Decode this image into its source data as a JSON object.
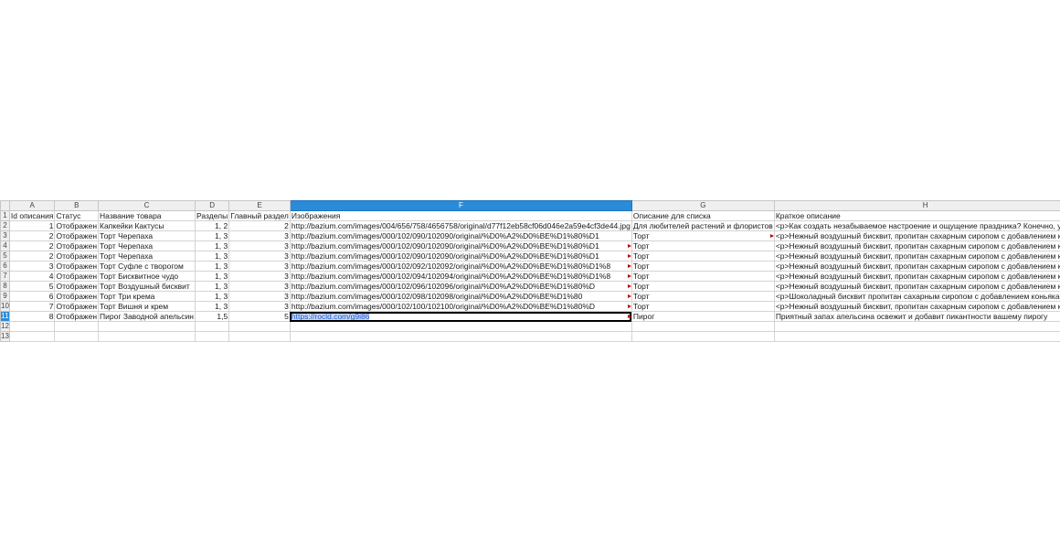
{
  "columns": [
    "A",
    "B",
    "C",
    "D",
    "E",
    "F",
    "G",
    "H"
  ],
  "active_cell": "F11",
  "rows": [
    {
      "n": "1",
      "cells": [
        "Id описания",
        "Статус",
        "Название товара",
        "Разделы",
        "Главный раздел",
        "Изображения",
        "Описание для списка",
        "Краткое описание"
      ]
    },
    {
      "n": "2",
      "cells": [
        "1",
        "Отображен",
        "Капкейки Кактусы",
        "1, 2",
        "2",
        "http://bazium.com/images/004/656/758/4656758/original/d77f12eb58cf06d046e2a59e4cf3de44.jpg",
        "Для любителей растений и флористов",
        "<p>Как создать незабываемое настроение и ощущение праздника? Конечно, уди"
      ]
    },
    {
      "n": "3",
      "cells": [
        "2",
        "Отображен",
        "Торт Черепаха",
        "1, 3",
        "3",
        "http://bazium.com/images/000/102/090/102090/original/%D0%A2%D0%BE%D1%80%D1",
        "Торт",
        "<p>Нежный воздушный бисквит, пропитан сахарным сиропом с добавлением кон"
      ]
    },
    {
      "n": "4",
      "cells": [
        "2",
        "Отображен",
        "Торт Черепаха",
        "1, 3",
        "3",
        "http://bazium.com/images/000/102/090/102090/original/%D0%A2%D0%BE%D1%80%D1",
        "Торт",
        "<p>Нежный воздушный бисквит, пропитан сахарным сиропом с добавлением кон"
      ]
    },
    {
      "n": "5",
      "cells": [
        "2",
        "Отображен",
        "Торт Черепаха",
        "1, 3",
        "3",
        "http://bazium.com/images/000/102/090/102090/original/%D0%A2%D0%BE%D1%80%D1",
        "Торт",
        "<p>Нежный воздушный бисквит, пропитан сахарным сиропом с добавлением кон"
      ]
    },
    {
      "n": "6",
      "cells": [
        "3",
        "Отображен",
        "Торт Суфле с творогом",
        "1, 3",
        "3",
        "http://bazium.com/images/000/102/092/102092/original/%D0%A2%D0%BE%D1%80%D1%8",
        "Торт",
        "<p>Нежный воздушный бисквит, пропитан сахарным сиропом с добавлением кон"
      ]
    },
    {
      "n": "7",
      "cells": [
        "4",
        "Отображен",
        "Торт Бисквитное чудо",
        "1, 3",
        "3",
        "http://bazium.com/images/000/102/094/102094/original/%D0%A2%D0%BE%D1%80%D1%8",
        "Торт",
        "<p>Нежный воздушный бисквит, пропитан сахарным сиропом с добавлением кон"
      ]
    },
    {
      "n": "8",
      "cells": [
        "5",
        "Отображен",
        "Торт Воздушный бисквит",
        "1, 3",
        "3",
        "http://bazium.com/images/000/102/096/102096/original/%D0%A2%D0%BE%D1%80%D",
        "Торт",
        "<p>Нежный воздушный бисквит, пропитан сахарным сиропом с добавлением кон"
      ]
    },
    {
      "n": "9",
      "cells": [
        "6",
        "Отображен",
        "Торт Три крема",
        "1, 3",
        "3",
        "http://bazium.com/images/000/102/098/102098/original/%D0%A2%D0%BE%D1%80",
        "Торт",
        "<p>Шоколадный бисквит пропитан сахарным сиропом с добавлением коньяка или"
      ]
    },
    {
      "n": "10",
      "cells": [
        "7",
        "Отображен",
        "Торт Вишня и крем",
        "1, 3",
        "3",
        "http://bazium.com/images/000/102/100/102100/original/%D0%A2%D0%BE%D1%80%D",
        "Торт",
        "<p>Нежный воздушный бисквит, пропитан сахарным сиропом с добавлением кон"
      ]
    },
    {
      "n": "11",
      "cells": [
        "8",
        "Отображен",
        "Пирог Заводной апельсин",
        "1,5",
        "5",
        "https://rocld.com/g9i86",
        "Пирог",
        "Приятный запах апельсина освежит и добавит пикантности вашему пирогу"
      ]
    },
    {
      "n": "12",
      "cells": [
        "",
        "",
        "",
        "",
        "",
        "",
        "",
        ""
      ]
    },
    {
      "n": "13",
      "cells": [
        "",
        "",
        "",
        "",
        "",
        "",
        "",
        ""
      ]
    }
  ]
}
